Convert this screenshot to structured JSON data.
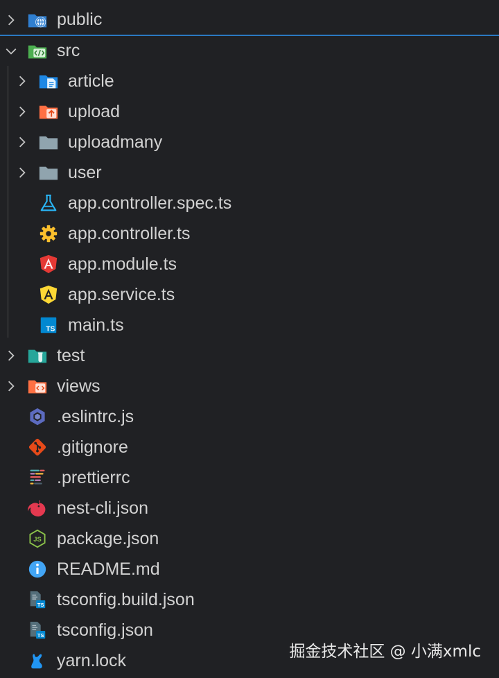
{
  "explorer": {
    "items": [
      {
        "label": "public",
        "icon": "folder-public-icon",
        "chevron": "right",
        "depth": 0
      },
      {
        "label": "src",
        "icon": "folder-src-icon",
        "chevron": "down",
        "depth": 0
      },
      {
        "label": "article",
        "icon": "folder-article-icon",
        "chevron": "right",
        "depth": 1
      },
      {
        "label": "upload",
        "icon": "folder-upload-icon",
        "chevron": "right",
        "depth": 1
      },
      {
        "label": "uploadmany",
        "icon": "folder-icon",
        "chevron": "right",
        "depth": 1
      },
      {
        "label": "user",
        "icon": "folder-icon",
        "chevron": "right",
        "depth": 1
      },
      {
        "label": "app.controller.spec.ts",
        "icon": "test-flask-icon",
        "depth": 1
      },
      {
        "label": "app.controller.ts",
        "icon": "gear-icon",
        "depth": 1
      },
      {
        "label": "app.module.ts",
        "icon": "angular-module-icon",
        "depth": 1
      },
      {
        "label": "app.service.ts",
        "icon": "angular-service-icon",
        "depth": 1
      },
      {
        "label": "main.ts",
        "icon": "typescript-icon",
        "depth": 1
      },
      {
        "label": "test",
        "icon": "folder-test-icon",
        "chevron": "right",
        "depth": 0
      },
      {
        "label": "views",
        "icon": "folder-views-icon",
        "chevron": "right",
        "depth": 0
      },
      {
        "label": ".eslintrc.js",
        "icon": "eslint-icon",
        "depth": 0
      },
      {
        "label": ".gitignore",
        "icon": "git-icon",
        "depth": 0
      },
      {
        "label": ".prettierrc",
        "icon": "prettier-icon",
        "depth": 0
      },
      {
        "label": "nest-cli.json",
        "icon": "nestjs-icon",
        "depth": 0
      },
      {
        "label": "package.json",
        "icon": "nodejs-icon",
        "depth": 0
      },
      {
        "label": "README.md",
        "icon": "info-icon",
        "depth": 0
      },
      {
        "label": "tsconfig.build.json",
        "icon": "tsconfig-icon",
        "depth": 0
      },
      {
        "label": "tsconfig.json",
        "icon": "tsconfig-icon",
        "depth": 0
      },
      {
        "label": "yarn.lock",
        "icon": "yarn-icon",
        "depth": 0
      }
    ]
  },
  "watermark": "掘金技术社区 @ 小满xmlc",
  "colors": {
    "background": "#202124",
    "selection_border": "#2b79c2",
    "text": "#d2d2d2"
  }
}
